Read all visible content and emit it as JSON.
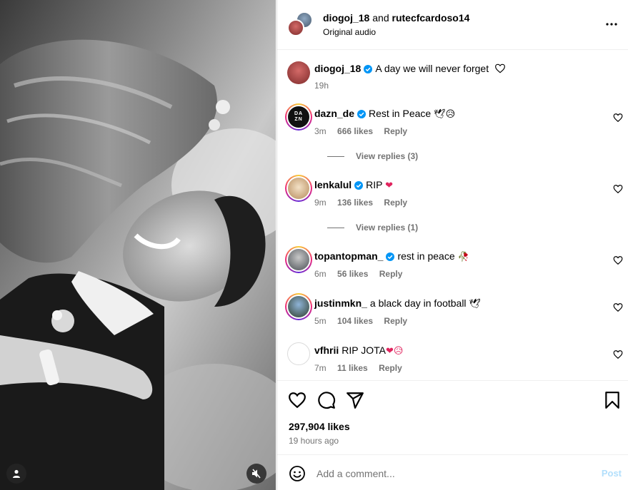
{
  "header": {
    "user1": "diogoj_18",
    "and": "and",
    "user2": "rutecfcardoso14",
    "audio": "Original audio"
  },
  "caption": {
    "username": "diogoj_18",
    "text": "A day we will never forget",
    "time": "19h"
  },
  "comments": [
    {
      "username": "dazn_de",
      "text": "Rest in Peace",
      "emoji": "🕊😥",
      "time": "3m",
      "likes": "666 likes",
      "reply": "Reply",
      "view_replies": "View replies (3)",
      "verified": true
    },
    {
      "username": "lenkalul",
      "text": "RIP",
      "emoji": "❤",
      "time": "9m",
      "likes": "136 likes",
      "reply": "Reply",
      "view_replies": "View replies (1)",
      "verified": true
    },
    {
      "username": "topantopman_",
      "text": "rest in peace",
      "emoji": "🥀",
      "time": "6m",
      "likes": "56 likes",
      "reply": "Reply",
      "verified": true
    },
    {
      "username": "justinmkn_",
      "text": "a black day in football",
      "emoji": "🕊",
      "time": "5m",
      "likes": "104 likes",
      "reply": "Reply",
      "verified": false
    },
    {
      "username": "vfhrii",
      "text": "RIP JOTA",
      "emoji": "❤😥",
      "time": "7m",
      "likes": "11 likes",
      "reply": "Reply",
      "verified": false
    }
  ],
  "dazn_logo": "DA ZN",
  "actions": {
    "likes": "297,904 likes",
    "ago": "19 hours ago"
  },
  "composer": {
    "placeholder": "Add a comment...",
    "post": "Post"
  },
  "colors": {
    "verified": "#0095f6",
    "muted": "#737373",
    "post_disabled": "#b2dffc",
    "heart_red": "#e0245e"
  }
}
